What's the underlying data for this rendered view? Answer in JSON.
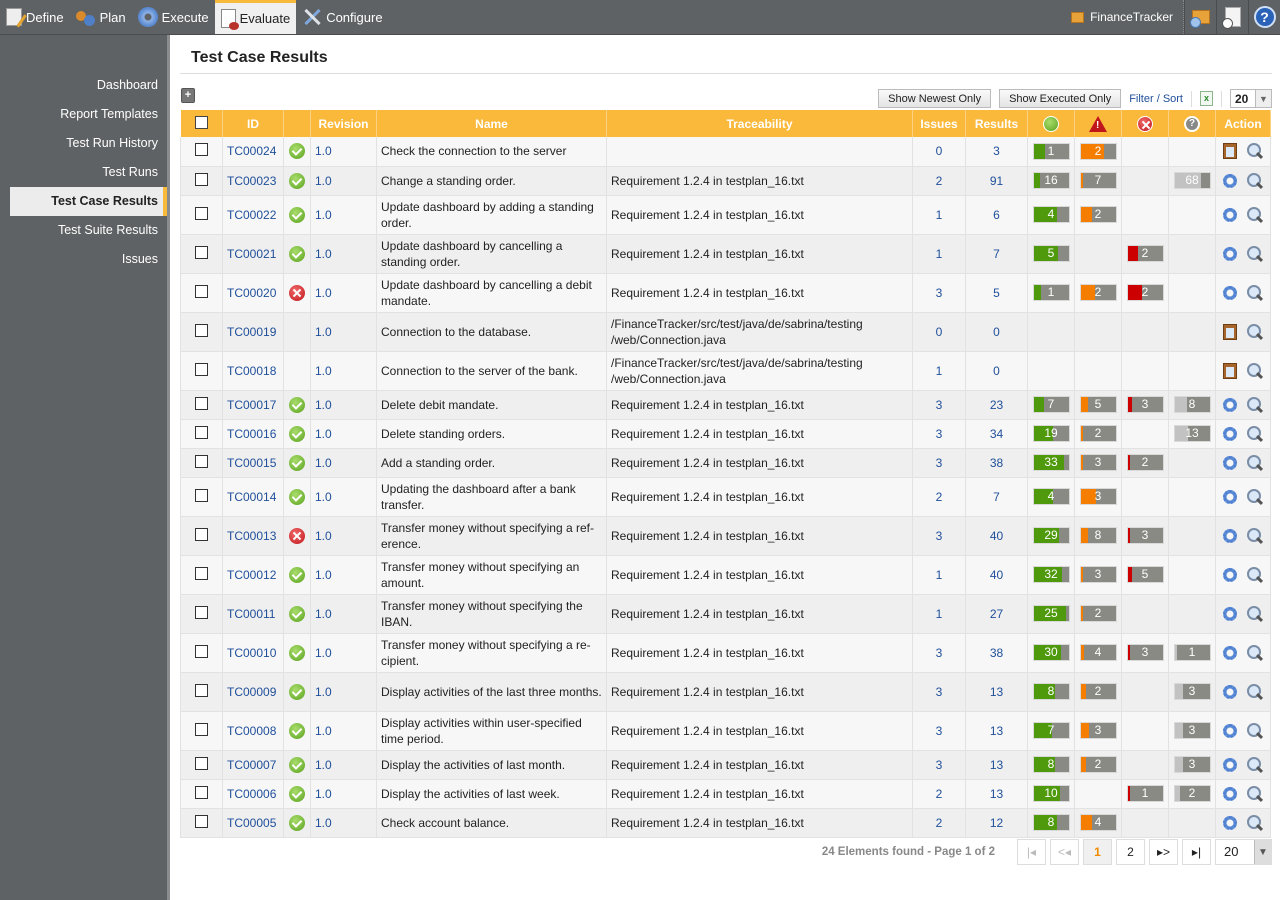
{
  "topnav": {
    "items": [
      {
        "label": "Define",
        "icon": "define-icon"
      },
      {
        "label": "Plan",
        "icon": "plan-icon"
      },
      {
        "label": "Execute",
        "icon": "execute-gear-icon"
      },
      {
        "label": "Evaluate",
        "icon": "evaluate-icon",
        "active": true
      },
      {
        "label": "Configure",
        "icon": "configure-tools-icon"
      }
    ],
    "project": "FinanceTracker",
    "accent": "#f9b93a"
  },
  "sidebar": {
    "items": [
      {
        "label": "Dashboard"
      },
      {
        "label": "Report Templates"
      },
      {
        "label": "Test Run History"
      },
      {
        "label": "Test Runs"
      },
      {
        "label": "Test Case Results",
        "active": true
      },
      {
        "label": "Test Suite Results"
      },
      {
        "label": "Issues"
      }
    ]
  },
  "page": {
    "title": "Test Case Results"
  },
  "toolbar": {
    "show_newest": "Show Newest Only",
    "show_executed": "Show Executed Only",
    "filter_sort": "Filter / Sort",
    "page_size": "20"
  },
  "table": {
    "headers": {
      "id": "ID",
      "revision": "Revision",
      "name": "Name",
      "traceability": "Traceability",
      "issues": "Issues",
      "results": "Results",
      "action": "Action"
    },
    "colors": {
      "passed": "#4f9a0c",
      "warning": "#f57d00",
      "failed": "#cc0000",
      "unknown": "#c2c2c2",
      "bar_bg": "#898a84"
    },
    "rows": [
      {
        "id": "TC00024",
        "status": "pass",
        "revision": "1.0",
        "name": "Check the connection to the server",
        "trace": "",
        "issues": "0",
        "results": "3",
        "passed": {
          "v": "1",
          "f": 0.33
        },
        "warn": {
          "v": "2",
          "f": 0.67
        },
        "failed": null,
        "unknown": null,
        "action": "clip",
        "h": 1
      },
      {
        "id": "TC00023",
        "status": "pass",
        "revision": "1.0",
        "name": "Change a standing order.",
        "trace": "Requirement 1.2.4 in testplan_16.txt",
        "issues": "2",
        "results": "91",
        "passed": {
          "v": "16",
          "f": 0.18
        },
        "warn": {
          "v": "7",
          "f": 0.08
        },
        "failed": null,
        "unknown": {
          "v": "68",
          "f": 0.75
        },
        "action": "gear",
        "h": 1
      },
      {
        "id": "TC00022",
        "status": "pass",
        "revision": "1.0",
        "name": "Update dashboard by adding a standing order.",
        "trace": "Requirement 1.2.4 in testplan_16.txt",
        "issues": "1",
        "results": "6",
        "passed": {
          "v": "4",
          "f": 0.67
        },
        "warn": {
          "v": "2",
          "f": 0.33
        },
        "failed": null,
        "unknown": null,
        "action": "gear",
        "h": 2
      },
      {
        "id": "TC00021",
        "status": "pass",
        "revision": "1.0",
        "name": "Update dashboard by cancelling a standing order.",
        "trace": "Requirement 1.2.4 in testplan_16.txt",
        "issues": "1",
        "results": "7",
        "passed": {
          "v": "5",
          "f": 0.71
        },
        "warn": null,
        "failed": {
          "v": "2",
          "f": 0.29
        },
        "unknown": null,
        "action": "gear",
        "h": 2
      },
      {
        "id": "TC00020",
        "status": "fail",
        "revision": "1.0",
        "name": "Update dashboard by cancelling a debit mandate.",
        "trace": "Requirement 1.2.4 in testplan_16.txt",
        "issues": "3",
        "results": "5",
        "passed": {
          "v": "1",
          "f": 0.2
        },
        "warn": {
          "v": "2",
          "f": 0.4
        },
        "failed": {
          "v": "2",
          "f": 0.4
        },
        "unknown": null,
        "action": "gear",
        "h": 2
      },
      {
        "id": "TC00019",
        "status": "",
        "revision": "1.0",
        "name": "Connection to the database.",
        "trace": "/FinanceTracker/src/test/java/de/sabrina/testing /web/Connection.java",
        "issues": "0",
        "results": "0",
        "passed": null,
        "warn": null,
        "failed": null,
        "unknown": null,
        "action": "clip",
        "h": 2
      },
      {
        "id": "TC00018",
        "status": "",
        "revision": "1.0",
        "name": "Connection to the server of the bank.",
        "trace": "/FinanceTracker/src/test/java/de/sabrina/testing /web/Connection.java",
        "issues": "1",
        "results": "0",
        "passed": null,
        "warn": null,
        "failed": null,
        "unknown": null,
        "action": "clip",
        "h": 2
      },
      {
        "id": "TC00017",
        "status": "pass",
        "revision": "1.0",
        "name": "Delete debit mandate.",
        "trace": "Requirement 1.2.4 in testplan_16.txt",
        "issues": "3",
        "results": "23",
        "passed": {
          "v": "7",
          "f": 0.3
        },
        "warn": {
          "v": "5",
          "f": 0.22
        },
        "failed": {
          "v": "3",
          "f": 0.13
        },
        "unknown": {
          "v": "8",
          "f": 0.35
        },
        "action": "gear",
        "h": 1
      },
      {
        "id": "TC00016",
        "status": "pass",
        "revision": "1.0",
        "name": "Delete standing orders.",
        "trace": "Requirement 1.2.4 in testplan_16.txt",
        "issues": "3",
        "results": "34",
        "passed": {
          "v": "19",
          "f": 0.56
        },
        "warn": {
          "v": "2",
          "f": 0.06
        },
        "failed": null,
        "unknown": {
          "v": "13",
          "f": 0.38
        },
        "action": "gear",
        "h": 1
      },
      {
        "id": "TC00015",
        "status": "pass",
        "revision": "1.0",
        "name": "Add a standing order.",
        "trace": "Requirement 1.2.4 in testplan_16.txt",
        "issues": "3",
        "results": "38",
        "passed": {
          "v": "33",
          "f": 0.87
        },
        "warn": {
          "v": "3",
          "f": 0.08
        },
        "failed": {
          "v": "2",
          "f": 0.05
        },
        "unknown": null,
        "action": "gear",
        "h": 1
      },
      {
        "id": "TC00014",
        "status": "pass",
        "revision": "1.0",
        "name": "Updating the dashboard after a bank transfer.",
        "trace": "Requirement 1.2.4 in testplan_16.txt",
        "issues": "2",
        "results": "7",
        "passed": {
          "v": "4",
          "f": 0.57
        },
        "warn": {
          "v": "3",
          "f": 0.43
        },
        "failed": null,
        "unknown": null,
        "action": "gear",
        "h": 2
      },
      {
        "id": "TC00013",
        "status": "fail",
        "revision": "1.0",
        "name": "Transfer money without specifying a ref-erence.",
        "trace": "Requirement 1.2.4 in testplan_16.txt",
        "issues": "3",
        "results": "40",
        "passed": {
          "v": "29",
          "f": 0.73
        },
        "warn": {
          "v": "8",
          "f": 0.2
        },
        "failed": {
          "v": "3",
          "f": 0.08
        },
        "unknown": null,
        "action": "gear",
        "h": 2
      },
      {
        "id": "TC00012",
        "status": "pass",
        "revision": "1.0",
        "name": "Transfer money without specifying an amount.",
        "trace": "Requirement 1.2.4 in testplan_16.txt",
        "issues": "1",
        "results": "40",
        "passed": {
          "v": "32",
          "f": 0.8
        },
        "warn": {
          "v": "3",
          "f": 0.08
        },
        "failed": {
          "v": "5",
          "f": 0.12
        },
        "unknown": null,
        "action": "gear",
        "h": 2
      },
      {
        "id": "TC00011",
        "status": "pass",
        "revision": "1.0",
        "name": "Transfer money without specifying the IBAN.",
        "trace": "Requirement 1.2.4 in testplan_16.txt",
        "issues": "1",
        "results": "27",
        "passed": {
          "v": "25",
          "f": 0.93
        },
        "warn": {
          "v": "2",
          "f": 0.07
        },
        "failed": null,
        "unknown": null,
        "action": "gear",
        "h": 2
      },
      {
        "id": "TC00010",
        "status": "pass",
        "revision": "1.0",
        "name": "Transfer money without specifying a re-cipient.",
        "trace": "Requirement 1.2.4 in testplan_16.txt",
        "issues": "3",
        "results": "38",
        "passed": {
          "v": "30",
          "f": 0.79
        },
        "warn": {
          "v": "4",
          "f": 0.11
        },
        "failed": {
          "v": "3",
          "f": 0.08
        },
        "unknown": {
          "v": "1",
          "f": 0.03
        },
        "action": "gear",
        "h": 2
      },
      {
        "id": "TC00009",
        "status": "pass",
        "revision": "1.0",
        "name": "Display activities of the last three months.",
        "trace": "Requirement 1.2.4 in testplan_16.txt",
        "issues": "3",
        "results": "13",
        "passed": {
          "v": "8",
          "f": 0.62
        },
        "warn": {
          "v": "2",
          "f": 0.15
        },
        "failed": null,
        "unknown": {
          "v": "3",
          "f": 0.23
        },
        "action": "gear",
        "h": 2
      },
      {
        "id": "TC00008",
        "status": "pass",
        "revision": "1.0",
        "name": "Display activities within user-specified time period.",
        "trace": "Requirement 1.2.4 in testplan_16.txt",
        "issues": "3",
        "results": "13",
        "passed": {
          "v": "7",
          "f": 0.54
        },
        "warn": {
          "v": "3",
          "f": 0.23
        },
        "failed": null,
        "unknown": {
          "v": "3",
          "f": 0.23
        },
        "action": "gear",
        "h": 2
      },
      {
        "id": "TC00007",
        "status": "pass",
        "revision": "1.0",
        "name": "Display the activities of last month.",
        "trace": "Requirement 1.2.4 in testplan_16.txt",
        "issues": "3",
        "results": "13",
        "passed": {
          "v": "8",
          "f": 0.62
        },
        "warn": {
          "v": "2",
          "f": 0.15
        },
        "failed": null,
        "unknown": {
          "v": "3",
          "f": 0.23
        },
        "action": "gear",
        "h": 1
      },
      {
        "id": "TC00006",
        "status": "pass",
        "revision": "1.0",
        "name": "Display the activities of last week.",
        "trace": "Requirement 1.2.4 in testplan_16.txt",
        "issues": "2",
        "results": "13",
        "passed": {
          "v": "10",
          "f": 0.77
        },
        "warn": null,
        "failed": {
          "v": "1",
          "f": 0.08
        },
        "unknown": {
          "v": "2",
          "f": 0.15
        },
        "action": "gear",
        "h": 1
      },
      {
        "id": "TC00005",
        "status": "pass",
        "revision": "1.0",
        "name": "Check account balance.",
        "trace": "Requirement 1.2.4 in testplan_16.txt",
        "issues": "2",
        "results": "12",
        "passed": {
          "v": "8",
          "f": 0.67
        },
        "warn": {
          "v": "4",
          "f": 0.33
        },
        "failed": null,
        "unknown": null,
        "action": "gear",
        "h": 1
      }
    ]
  },
  "pager": {
    "summary": "24 Elements found - Page 1 of 2",
    "first": "⏮",
    "prev": "<◂",
    "pages": [
      "1",
      "2"
    ],
    "current": "1",
    "next": "▸>",
    "last": "▸|",
    "page_size": "20"
  }
}
